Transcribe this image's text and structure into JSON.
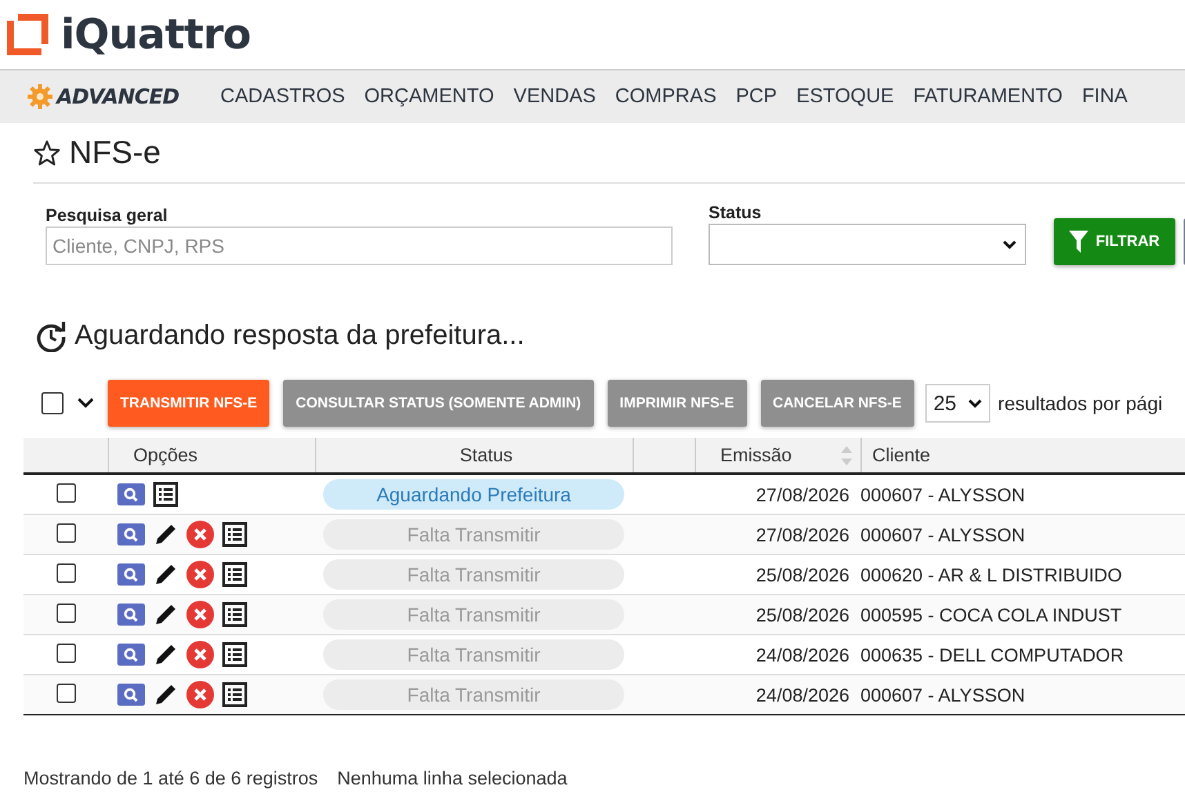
{
  "brand": {
    "name": "iQuattro"
  },
  "nav": {
    "product": "ADVANCED",
    "items": [
      "CADASTROS",
      "ORÇAMENTO",
      "VENDAS",
      "COMPRAS",
      "PCP",
      "ESTOQUE",
      "FATURAMENTO",
      "FINA"
    ]
  },
  "page": {
    "title": "NFS-e",
    "favorite": false
  },
  "filters": {
    "search_label": "Pesquisa geral",
    "search_placeholder": "Cliente, CNPJ, RPS",
    "status_label": "Status",
    "filter_button": "FILTRAR"
  },
  "section": {
    "heading": "Aguardando resposta da prefeitura..."
  },
  "toolbar": {
    "select_all_checked": false,
    "buttons": [
      {
        "label": "TRANSMITIR NFS-E",
        "kind": "primary"
      },
      {
        "label": "CONSULTAR STATUS (SOMENTE ADMIN)",
        "kind": "secondary"
      },
      {
        "label": "IMPRIMIR NFS-E",
        "kind": "secondary"
      },
      {
        "label": "CANCELAR NFS-E",
        "kind": "secondary"
      }
    ],
    "page_size": "25",
    "page_size_label": "resultados por pági"
  },
  "table": {
    "columns": [
      "Opções",
      "Status",
      "",
      "Emissão",
      "Cliente"
    ],
    "rows": [
      {
        "checked": false,
        "actions": [
          {
            "kind": "view"
          },
          {
            "kind": "list"
          }
        ],
        "status": "Aguardando Prefeitura",
        "kind": "waiting",
        "emissao": "27/08/2026",
        "cliente": "000607 - ALYSSON"
      },
      {
        "checked": false,
        "actions": [
          {
            "kind": "view"
          },
          {
            "kind": "edit"
          },
          {
            "kind": "delete"
          },
          {
            "kind": "list"
          }
        ],
        "status": "Falta Transmitir",
        "kind": "pending",
        "emissao": "27/08/2026",
        "cliente": "000607 - ALYSSON"
      },
      {
        "checked": false,
        "actions": [
          {
            "kind": "view"
          },
          {
            "kind": "edit"
          },
          {
            "kind": "delete"
          },
          {
            "kind": "list"
          }
        ],
        "status": "Falta Transmitir",
        "kind": "pending",
        "emissao": "25/08/2026",
        "cliente": "000620 - AR & L DISTRIBUIDO"
      },
      {
        "checked": false,
        "actions": [
          {
            "kind": "view"
          },
          {
            "kind": "edit"
          },
          {
            "kind": "delete"
          },
          {
            "kind": "list"
          }
        ],
        "status": "Falta Transmitir",
        "kind": "pending",
        "emissao": "25/08/2026",
        "cliente": "000595 - COCA COLA INDUST"
      },
      {
        "checked": false,
        "actions": [
          {
            "kind": "view"
          },
          {
            "kind": "edit"
          },
          {
            "kind": "delete"
          },
          {
            "kind": "list"
          }
        ],
        "status": "Falta Transmitir",
        "kind": "pending",
        "emissao": "24/08/2026",
        "cliente": "000635 - DELL COMPUTADOR"
      },
      {
        "checked": false,
        "actions": [
          {
            "kind": "view"
          },
          {
            "kind": "edit"
          },
          {
            "kind": "delete"
          },
          {
            "kind": "list"
          }
        ],
        "status": "Falta Transmitir",
        "kind": "pending",
        "emissao": "24/08/2026",
        "cliente": "000607 - ALYSSON"
      }
    ]
  },
  "footer": {
    "info": "Mostrando de 1 até 6 de 6 registros",
    "selection": "Nenhuma linha selecionada"
  }
}
